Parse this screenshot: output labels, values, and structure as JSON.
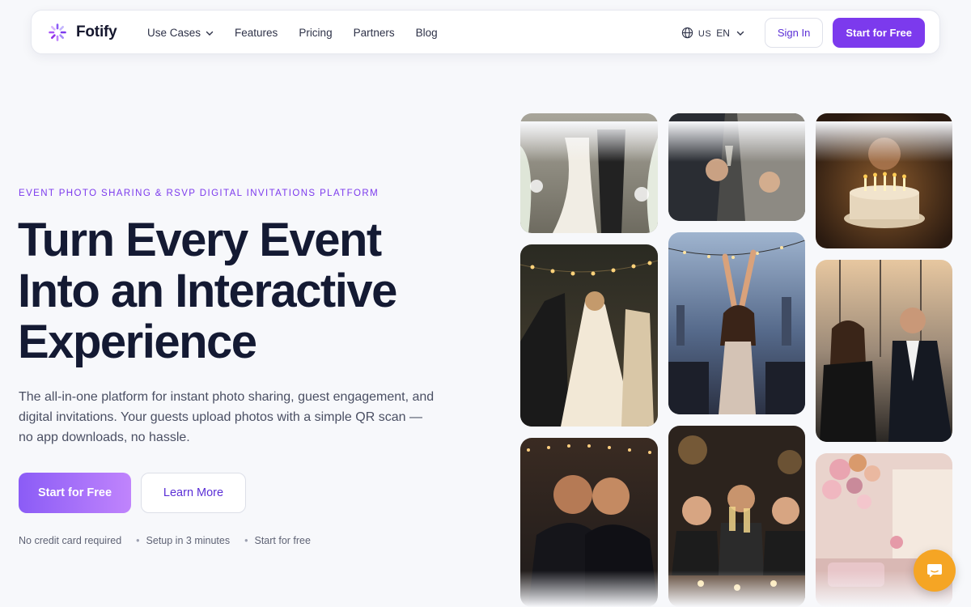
{
  "nav": {
    "brand": "Fotify",
    "links": [
      {
        "label": "Use Cases",
        "has_dropdown": true
      },
      {
        "label": "Features",
        "has_dropdown": false
      },
      {
        "label": "Pricing",
        "has_dropdown": false
      },
      {
        "label": "Partners",
        "has_dropdown": false
      },
      {
        "label": "Blog",
        "has_dropdown": false
      }
    ],
    "language": {
      "flag": "US",
      "code": "EN",
      "icon": "globe-icon"
    },
    "sign_in": "Sign In",
    "start_free": "Start for Free"
  },
  "hero": {
    "eyebrow": "EVENT PHOTO SHARING & RSVP DIGITAL INVITATIONS PLATFORM",
    "headline_lines": [
      "Turn Every Event",
      "Into an Interactive",
      "Experience"
    ],
    "subtext": "The all-in-one platform for instant photo sharing, guest engagement, and digital invitations. Your guests upload photos with a simple QR scan — no app downloads, no hassle.",
    "primary_cta": "Start for Free",
    "secondary_cta": "Learn More",
    "perks": [
      "No credit card required",
      "Setup in 3 minutes",
      "Start for free"
    ]
  },
  "gallery": {
    "photos": [
      {
        "subject": "wedding couple at altar"
      },
      {
        "subject": "guests toasting with wine"
      },
      {
        "subject": "birthday cake with candles"
      },
      {
        "subject": "wedding dance under string lights"
      },
      {
        "subject": "woman dancing on rooftop"
      },
      {
        "subject": "rooftop cocktail party"
      },
      {
        "subject": "two men hugging and laughing"
      },
      {
        "subject": "friends toasting champagne"
      },
      {
        "subject": "party room with balloons"
      }
    ]
  },
  "chat": {
    "icon": "chat-icon"
  },
  "colors": {
    "brand": "#7c3aed",
    "background": "#f7f8fb",
    "headline": "#141a33",
    "chat": "#f5a524"
  }
}
